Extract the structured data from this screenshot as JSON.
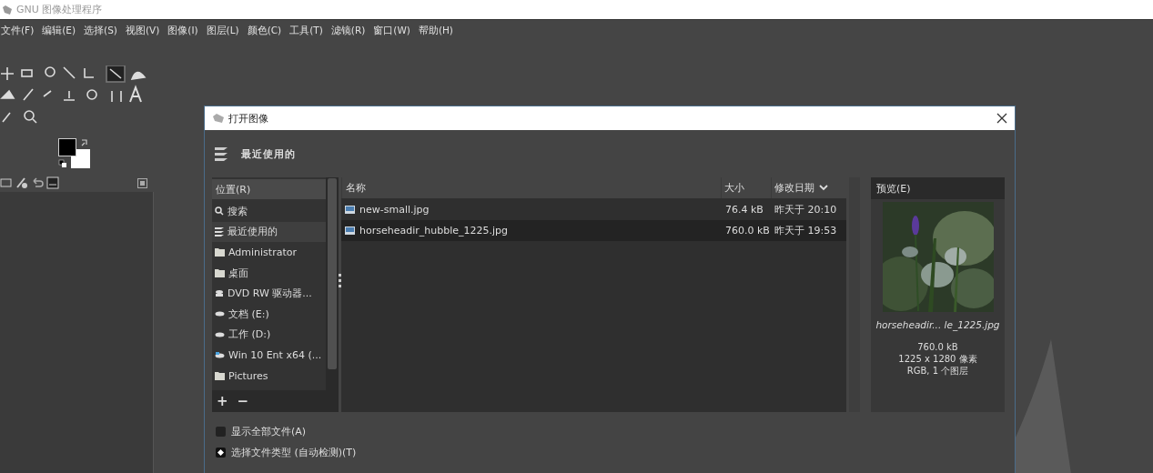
{
  "window": {
    "title": "GNU 图像处理程序"
  },
  "menu": [
    "文件(F)",
    "编辑(E)",
    "选择(S)",
    "视图(V)",
    "图像(I)",
    "图层(L)",
    "颜色(C)",
    "工具(T)",
    "滤镜(R)",
    "窗口(W)",
    "帮助(H)"
  ],
  "dialog": {
    "title": "打开图像",
    "location": "最近使用的",
    "places": {
      "header": "位置(R)",
      "items": [
        {
          "kind": "search",
          "label": "搜索",
          "selected": false
        },
        {
          "kind": "recent",
          "label": "最近使用的",
          "selected": true
        },
        {
          "kind": "folder",
          "label": "Administrator",
          "selected": false
        },
        {
          "kind": "folder",
          "label": "桌面",
          "selected": false
        },
        {
          "kind": "optical",
          "label": "DVD RW 驱动器...",
          "selected": false
        },
        {
          "kind": "drive",
          "label": "文档 (E:)",
          "selected": false
        },
        {
          "kind": "drive",
          "label": "工作 (D:)",
          "selected": false
        },
        {
          "kind": "system",
          "label": "Win 10 Ent x64 (...",
          "selected": false
        },
        {
          "kind": "folder",
          "label": "Pictures",
          "selected": false
        }
      ],
      "add": "+",
      "remove": "−"
    },
    "columns": {
      "name": "名称",
      "size": "大小",
      "date": "修改日期"
    },
    "files": [
      {
        "name": "new-small.jpg",
        "size": "76.4 kB",
        "date": "昨天于 20:10",
        "selected": false
      },
      {
        "name": "horseheadir_hubble_1225.jpg",
        "size": "760.0 kB",
        "date": "昨天于 19:53",
        "selected": true
      }
    ],
    "preview": {
      "label": "预览(E)",
      "filename": "horseheadir... le_1225.jpg",
      "info": [
        "760.0 kB",
        "1225 x 1280 像素",
        "RGB, 1 个图层"
      ]
    },
    "show_all": {
      "label": "显示全部文件(A)",
      "checked": false
    },
    "file_type": {
      "label": "选择文件类型 (自动检测)(T)",
      "expanded": false
    }
  }
}
